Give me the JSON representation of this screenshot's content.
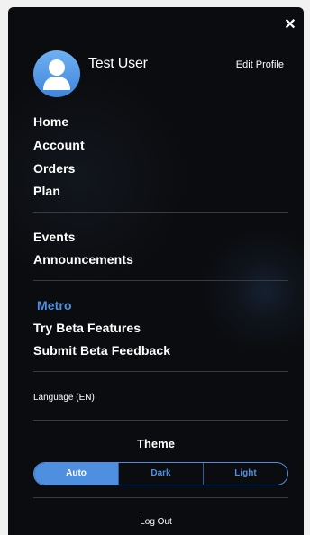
{
  "close_icon": "close-icon",
  "profile": {
    "name": "Test User",
    "edit_label": "Edit Profile",
    "avatar_icon": "user-avatar-icon",
    "avatar_color": "#4a8fe2"
  },
  "nav": {
    "group1": [
      "Home",
      "Account",
      "Orders",
      "Plan"
    ],
    "group2": [
      "Events",
      "Announcements"
    ],
    "group3": [
      "Metro",
      "Try Beta Features",
      "Submit Beta Feedback"
    ],
    "active_item": "Metro"
  },
  "language_label": "Language (EN)",
  "theme": {
    "title": "Theme",
    "options": [
      "Auto",
      "Dark",
      "Light"
    ],
    "selected": "Auto",
    "accent_color": "#4f8fe0"
  },
  "logout_label": "Log Out"
}
